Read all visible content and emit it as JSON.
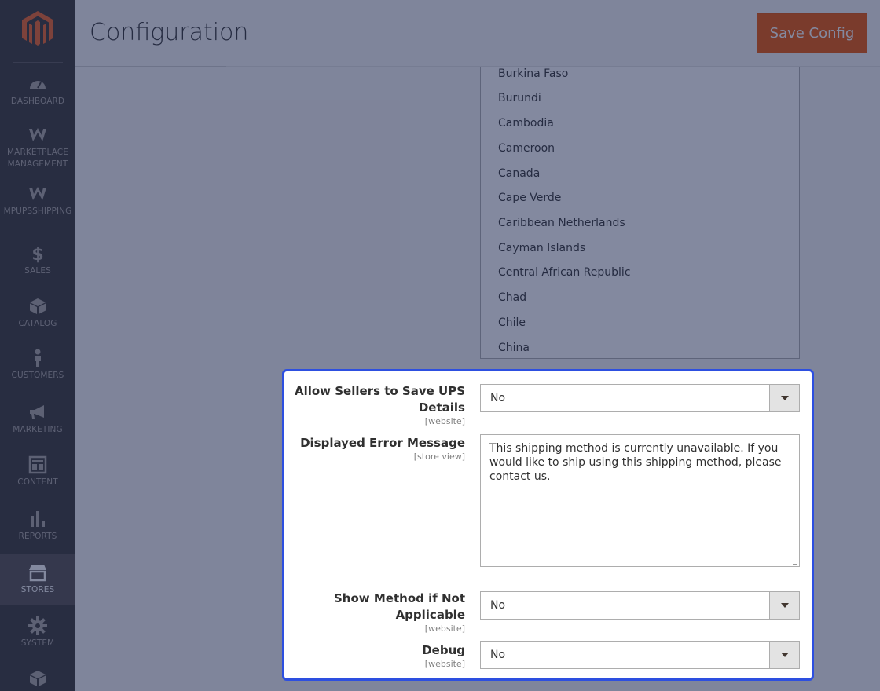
{
  "app": {
    "title": "Configuration",
    "save_label": "Save Config"
  },
  "sidebar": {
    "items": [
      {
        "label": "DASHBOARD",
        "icon": "dashboard-icon"
      },
      {
        "label": "MARKETPLACE MANAGEMENT",
        "icon": "marketplace-icon"
      },
      {
        "label": "MPUPSSHIPPING",
        "icon": "mpupsshipping-icon"
      },
      {
        "label": "SALES",
        "icon": "dollar-icon"
      },
      {
        "label": "CATALOG",
        "icon": "box-icon"
      },
      {
        "label": "CUSTOMERS",
        "icon": "person-icon"
      },
      {
        "label": "MARKETING",
        "icon": "megaphone-icon"
      },
      {
        "label": "CONTENT",
        "icon": "content-icon"
      },
      {
        "label": "REPORTS",
        "icon": "bar-chart-icon"
      },
      {
        "label": "STORES",
        "icon": "store-icon",
        "active": true
      },
      {
        "label": "SYSTEM",
        "icon": "gear-icon"
      },
      {
        "label": "",
        "icon": "extensions-icon"
      }
    ]
  },
  "countries": [
    "Burkina Faso",
    "Burundi",
    "Cambodia",
    "Cameroon",
    "Canada",
    "Cape Verde",
    "Caribbean Netherlands",
    "Cayman Islands",
    "Central African Republic",
    "Chad",
    "Chile",
    "China"
  ],
  "fields": {
    "allow_sellers": {
      "label_line1": "Allow Sellers to Save UPS",
      "label_line2": "Details",
      "scope": "[website]",
      "value": "No"
    },
    "error_message": {
      "label": "Displayed Error Message",
      "scope": "[store view]",
      "value": "This shipping method is currently unavailable. If you would like to ship using this shipping method, please contact us."
    },
    "show_method": {
      "label_line1": "Show Method if Not",
      "label_line2": "Applicable",
      "scope": "[website]",
      "value": "No"
    },
    "debug": {
      "label": "Debug",
      "scope": "[website]",
      "value": "No"
    }
  },
  "colors": {
    "accent": "#eb5202",
    "highlight": "#2d4fe0",
    "sidebar": "#373330"
  }
}
